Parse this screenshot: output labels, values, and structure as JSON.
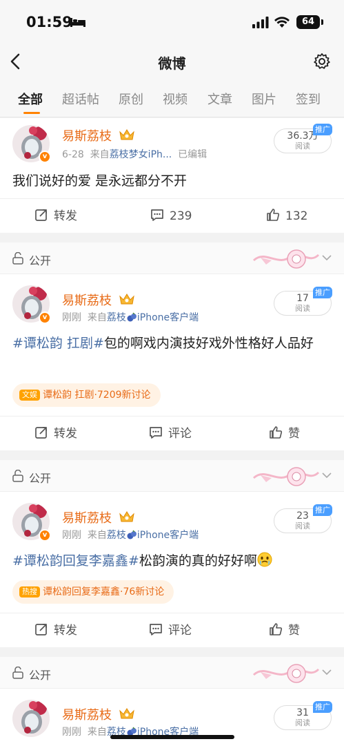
{
  "status_bar": {
    "time": "01:59",
    "battery": "64"
  },
  "header": {
    "title": "微博"
  },
  "tabs": [
    "全部",
    "超话帖",
    "原创",
    "视频",
    "文章",
    "图片",
    "签到"
  ],
  "colors": {
    "accent": "#ff8200",
    "username": "#e86b17",
    "link": "#4a6fa5",
    "promo": "#4a9eff"
  },
  "posts": [
    {
      "user": "易斯荔枝",
      "date": "6-28",
      "source_prefix": "来自",
      "source": "荔枝梦女iPh...",
      "edited": "已编辑",
      "read_count": "36.3万",
      "read_label": "阅读",
      "promo": "推广",
      "text": "我们说好的爱 是永远都分不开",
      "repost": "转发",
      "comments": "239",
      "likes": "132"
    },
    {
      "visibility": "公开",
      "user": "易斯荔枝",
      "date": "刚刚",
      "source_prefix": "来自",
      "source_name": "荔枝",
      "source_client": "iPhone客户端",
      "read_count": "17",
      "read_label": "阅读",
      "promo": "推广",
      "topic": "#谭松韵 扛剧#",
      "text": "包的啊戏内演技好戏外性格好人品好",
      "chip_tag": "文娱",
      "chip_text": "谭松韵 扛剧·7209新讨论",
      "repost": "转发",
      "comment": "评论",
      "like": "赞"
    },
    {
      "visibility": "公开",
      "user": "易斯荔枝",
      "date": "刚刚",
      "source_prefix": "来自",
      "source_name": "荔枝",
      "source_client": "iPhone客户端",
      "read_count": "23",
      "read_label": "阅读",
      "promo": "推广",
      "topic": "#谭松韵回复李嘉鑫#",
      "text": "松韵演的真的好好啊",
      "chip_tag": "热搜",
      "chip_text": "谭松韵回复李嘉鑫·76新讨论",
      "repost": "转发",
      "comment": "评论",
      "like": "赞"
    },
    {
      "visibility": "公开",
      "user": "易斯荔枝",
      "date": "刚刚",
      "source_prefix": "来自",
      "source_name": "荔枝",
      "source_client": "iPhone客户端",
      "read_count": "31",
      "read_label": "阅读",
      "promo": "推广"
    }
  ]
}
